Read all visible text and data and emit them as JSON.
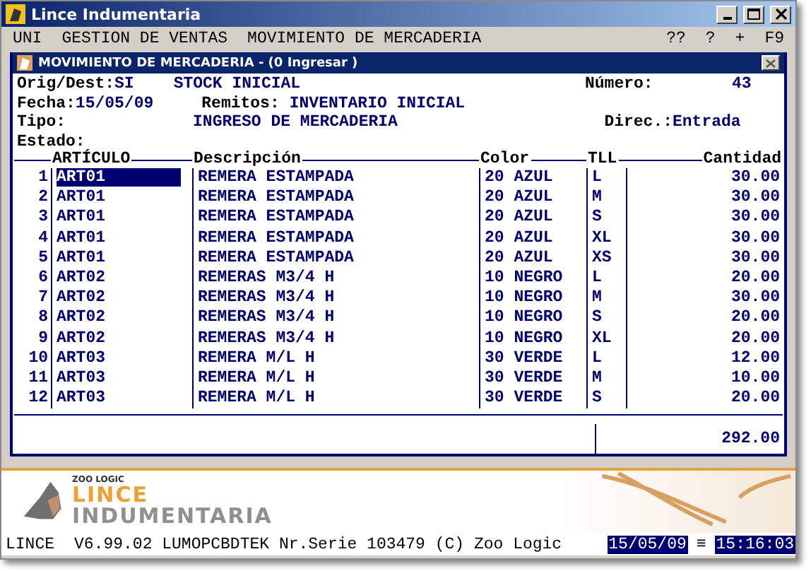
{
  "window": {
    "title": "Lince Indumentaria"
  },
  "menu": {
    "items": [
      "UNI",
      "GESTION DE VENTAS",
      "MOVIMIENTO DE MERCADERIA"
    ],
    "shortcuts": [
      "??",
      "?",
      "+",
      "F9"
    ]
  },
  "dialog": {
    "title": "MOVIMIENTO DE MERCADERIA - (0  Ingresar )",
    "fields": [
      {
        "label": "Orig/Dest:",
        "code": "SI",
        "value": "STOCK INICIAL",
        "right_label": "Número:",
        "right_value": "43"
      },
      {
        "label": "Fecha:",
        "code": "15/05/09",
        "value_label": "Remitos:",
        "value": "INVENTARIO INICIAL"
      },
      {
        "label": "Tipo:",
        "value": "INGRESO DE MERCADERIA",
        "right_label": "Direc.:",
        "right_value": "Entrada"
      },
      {
        "label": "Estado:"
      }
    ],
    "table": {
      "columns": [
        "ARTÍCULO",
        "Descripción",
        "Color",
        "TLL",
        "Cantidad"
      ],
      "rows": [
        {
          "n": "1",
          "cells": [
            "ART01",
            "REMERA ESTAMPADA",
            "20 AZUL",
            "L",
            "30.00"
          ],
          "selected": true
        },
        {
          "n": "2",
          "cells": [
            "ART01",
            "REMERA ESTAMPADA",
            "20 AZUL",
            "M",
            "30.00"
          ],
          "selected": false
        },
        {
          "n": "3",
          "cells": [
            "ART01",
            "REMERA ESTAMPADA",
            "20 AZUL",
            "S",
            "30.00"
          ],
          "selected": false
        },
        {
          "n": "4",
          "cells": [
            "ART01",
            "REMERA ESTAMPADA",
            "20 AZUL",
            "XL",
            "30.00"
          ],
          "selected": false
        },
        {
          "n": "5",
          "cells": [
            "ART01",
            "REMERA ESTAMPADA",
            "20 AZUL",
            "XS",
            "30.00"
          ],
          "selected": false
        },
        {
          "n": "6",
          "cells": [
            "ART02",
            "REMERAS M3/4 H",
            "10 NEGRO",
            "L",
            "20.00"
          ],
          "selected": false
        },
        {
          "n": "7",
          "cells": [
            "ART02",
            "REMERAS M3/4 H",
            "10 NEGRO",
            "M",
            "30.00"
          ],
          "selected": false
        },
        {
          "n": "8",
          "cells": [
            "ART02",
            "REMERAS M3/4 H",
            "10 NEGRO",
            "S",
            "20.00"
          ],
          "selected": false
        },
        {
          "n": "9",
          "cells": [
            "ART02",
            "REMERAS M3/4 H",
            "10 NEGRO",
            "XL",
            "20.00"
          ],
          "selected": false
        },
        {
          "n": "10",
          "cells": [
            "ART03",
            "REMERA M/L H",
            "30 VERDE",
            "L",
            "12.00"
          ],
          "selected": false
        },
        {
          "n": "11",
          "cells": [
            "ART03",
            "REMERA M/L H",
            "30 VERDE",
            "M",
            "10.00"
          ],
          "selected": false
        },
        {
          "n": "12",
          "cells": [
            "ART03",
            "REMERA M/L H",
            "30 VERDE",
            "S",
            "20.00"
          ],
          "selected": false
        }
      ],
      "total": "292.00"
    }
  },
  "banner": {
    "company": "ZOO LOGIC",
    "product_line1": "LINCE",
    "product_line2": "INDUMENTARIA"
  },
  "status_bar": {
    "app": "LINCE",
    "info": "V6.99.02 LUMOPCBDTEK Nr.Serie 103479 (C) Zoo Logic",
    "date": "15/05/09",
    "separator": "≡",
    "time": "15:16:03"
  }
}
